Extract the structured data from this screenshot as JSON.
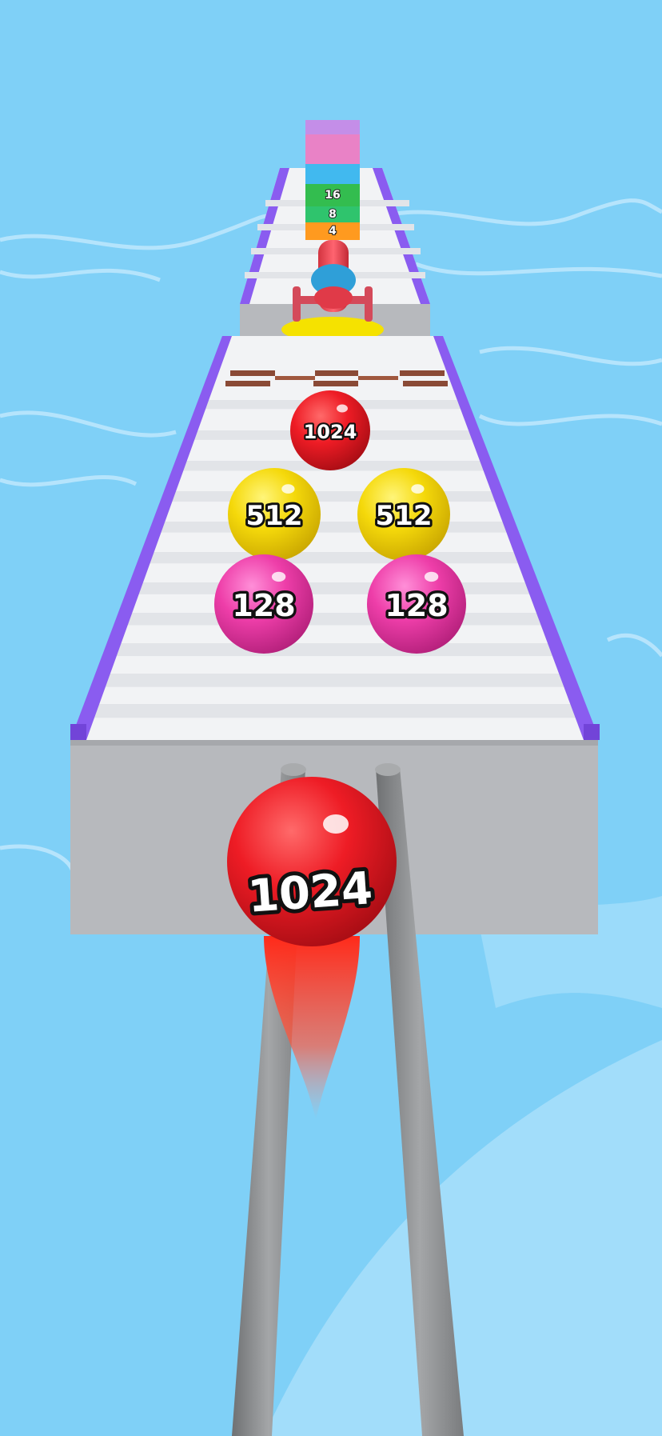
{
  "game": {
    "scene": "runner track over water",
    "colors": {
      "water": "#7fd0f7",
      "water_light": "#bfe8fd",
      "track_top": "#f2f3f5",
      "track_stripe": "#e2e4e8",
      "track_side": "#b7b9bd",
      "rail": "#8a5cf0",
      "rod": "#8e9092",
      "brick": "#8a4a36",
      "cannon_base": "#f5e200"
    },
    "player_ball": {
      "label": "1024",
      "color": "#ee1c25"
    },
    "track_balls": [
      {
        "label": "1024",
        "color": "#e81d26"
      },
      {
        "label": "512",
        "color": "#f5d90b"
      },
      {
        "label": "512",
        "color": "#f5d90b"
      },
      {
        "label": "128",
        "color": "#ee3ea9"
      },
      {
        "label": "128",
        "color": "#ee3ea9"
      }
    ],
    "distant_blocks": [
      {
        "label": "",
        "color": "#c48ee8"
      },
      {
        "label": "",
        "color": "#e982c6"
      },
      {
        "label": "",
        "color": "#41b9ef"
      },
      {
        "label": "16",
        "color": "#33bd4f"
      },
      {
        "label": "8",
        "color": "#2fc46d"
      },
      {
        "label": "4",
        "color": "#ff9a1f"
      }
    ]
  }
}
